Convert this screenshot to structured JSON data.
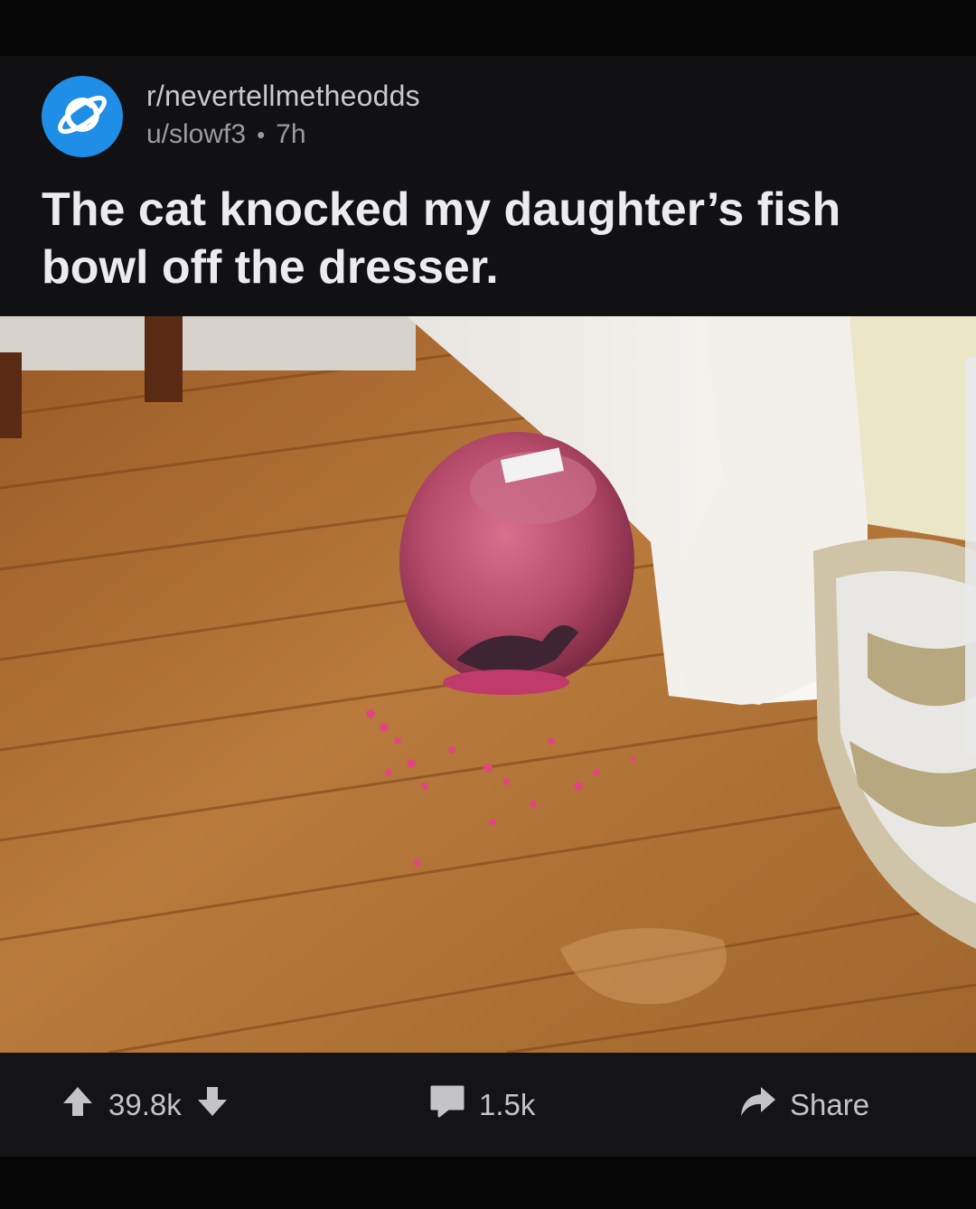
{
  "post": {
    "subreddit": "r/nevertellmetheodds",
    "author": "u/slowf3",
    "separator": "•",
    "age": "7h",
    "title": "The cat knocked my daughter’s fish bowl off the dresser."
  },
  "image": {
    "description_icon": "photo-image"
  },
  "actions": {
    "score": "39.8k",
    "comments": "1.5k",
    "share_label": "Share"
  },
  "colors": {
    "avatar_bg": "#1f8ee6",
    "background": "#111113",
    "text_primary": "#ececee",
    "text_secondary": "#9b9b9f"
  },
  "icons": {
    "avatar": "planet-icon",
    "upvote": "arrow-up-icon",
    "downvote": "arrow-down-icon",
    "comment": "comment-bubble-icon",
    "share": "share-arrow-icon"
  }
}
